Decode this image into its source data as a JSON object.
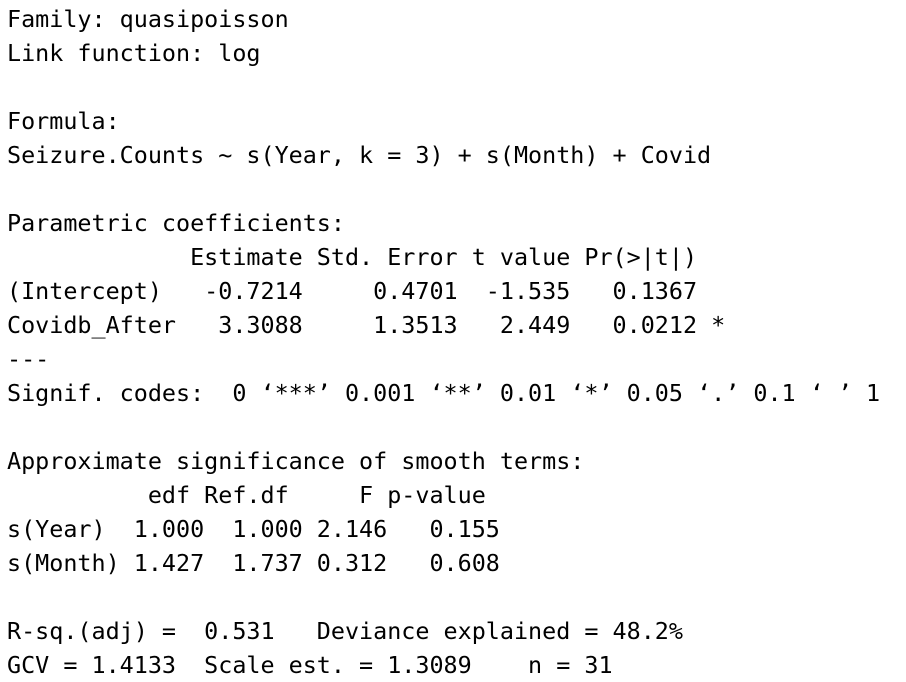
{
  "output": {
    "family": "Family: quasipoisson",
    "link": "Link function: log",
    "formula_heading": "Formula:",
    "formula": "Seizure.Counts ~ s(Year, k = 3) + s(Month) + Covid",
    "parametric": {
      "heading": "Parametric coefficients:",
      "header": "             Estimate Std. Error t value Pr(>|t|)",
      "rows": [
        "(Intercept)   -0.7214     0.4701  -1.535   0.1367",
        "Covidb_After   3.3088     1.3513   2.449   0.0212 *"
      ]
    },
    "separator": "---",
    "signif_codes": "Signif. codes:  0 ‘***’ 0.001 ‘**’ 0.01 ‘*’ 0.05 ‘.’ 0.1 ‘ ’ 1",
    "smooth": {
      "heading": "Approximate significance of smooth terms:",
      "header": "          edf Ref.df     F p-value",
      "rows": [
        "s(Year)  1.000  1.000 2.146   0.155",
        "s(Month) 1.427  1.737 0.312   0.608"
      ]
    },
    "fit_line_1": "R-sq.(adj) =  0.531   Deviance explained = 48.2%",
    "fit_line_2": "GCV = 1.4133  Scale est. = 1.3089    n = 31"
  }
}
